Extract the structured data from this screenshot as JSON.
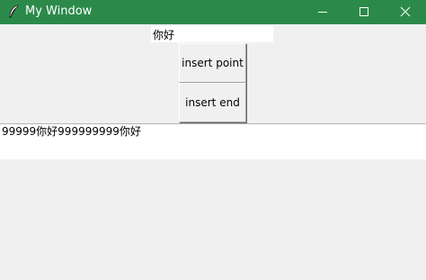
{
  "window": {
    "title": "My Window",
    "titlebar_color": "#2b8a4a",
    "icon": "feather-icon",
    "controls": {
      "minimize": "minimize-icon",
      "maximize": "maximize-icon",
      "close": "close-icon"
    }
  },
  "entry": {
    "value": "你好"
  },
  "buttons": {
    "insert_point": "insert point",
    "insert_end": "insert end"
  },
  "text": {
    "content": "99999你好999999999你好"
  }
}
